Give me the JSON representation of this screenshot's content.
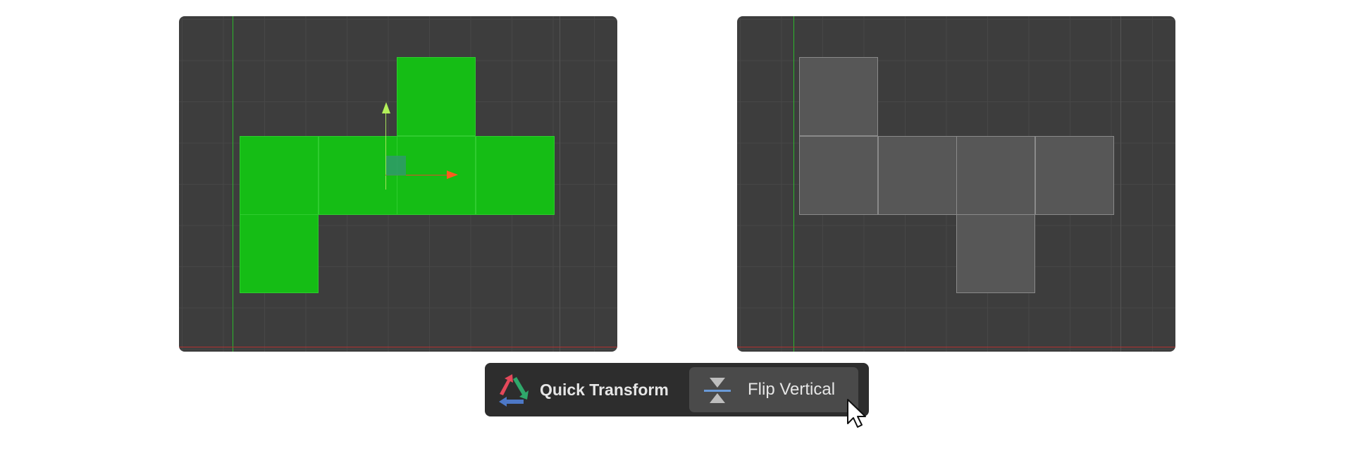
{
  "toolbar": {
    "title": "Quick Transform",
    "flip_vertical_label": "Flip Vertical",
    "logo_icon": "quick-transform-arrows-icon",
    "flip_icon": "flip-vertical-icon"
  },
  "viewports": {
    "left": {
      "state": "selected",
      "face_color": "#15bd15"
    },
    "right": {
      "state": "unselected",
      "face_color": "#575757"
    }
  },
  "colors": {
    "viewport_bg": "#3d3d3d",
    "toolbar_bg": "#2d2d2d",
    "button_bg": "#4a4a4a",
    "selection_green": "#15bd15",
    "gizmo_x": "#ff5a1e",
    "gizmo_y": "#b4f05a",
    "axis_y": "#2bb82b",
    "axis_x": "#b43232"
  }
}
